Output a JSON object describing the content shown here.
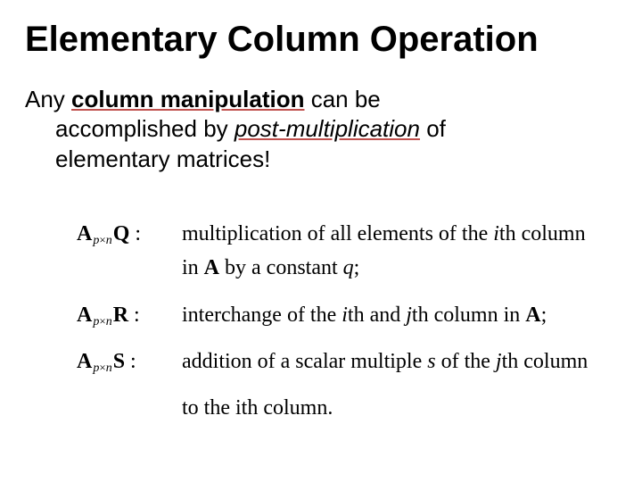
{
  "title": "Elementary Column Operation",
  "para": {
    "any": "Any ",
    "col_manip": "column manipulation",
    "can_be": " can be",
    "accomplished_by": "accomplished by ",
    "post_mult": "post-multiplication",
    "of": " of",
    "elem_matrices": "elementary matrices!"
  },
  "rows": {
    "Q": {
      "sym_A": "A",
      "sym_sub_p": "p",
      "sym_sub_x": "×",
      "sym_sub_n": "n",
      "sym_M": "Q",
      "colon": " :",
      "t1": "multiplication of all elements of the ",
      "i1": "i",
      "t2": "th column",
      "t3": "in ",
      "A2": "A",
      "t4": " by a constant ",
      "q": "q",
      "t5": ";"
    },
    "R": {
      "sym_A": "A",
      "sym_sub_p": "p",
      "sym_sub_x": "×",
      "sym_sub_n": "n",
      "sym_M": "R",
      "colon": " :",
      "t1": "interchange of the ",
      "i1": "i",
      "t2": "th and ",
      "j1": "j",
      "t3": "th column in ",
      "A2": "A",
      "t4": ";"
    },
    "S": {
      "sym_A": "A",
      "sym_sub_p": "p",
      "sym_sub_x": "×",
      "sym_sub_n": "n",
      "sym_M": "S",
      "colon": " :",
      "t1": "addition of a scalar multiple ",
      "s": "s",
      "t2": " of the ",
      "j1": "j",
      "t3": "th column",
      "t4": "to the ",
      "i1": "i",
      "t5": "th column."
    }
  }
}
